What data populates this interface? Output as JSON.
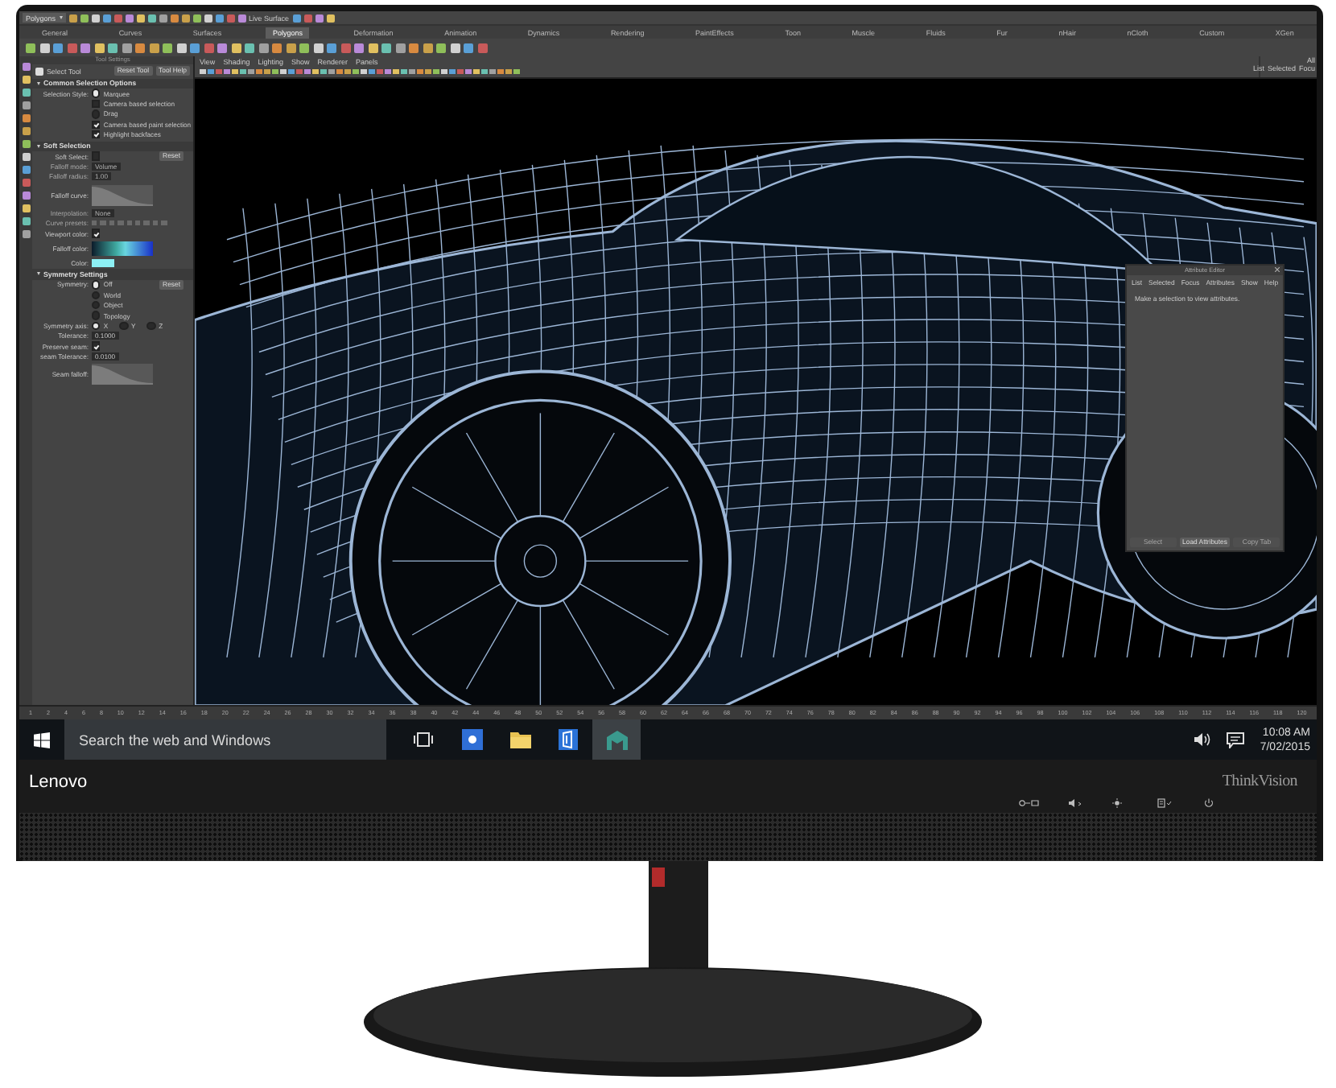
{
  "screen": {
    "top_bar": {
      "mode_menu": "Polygons",
      "live_surface": "Live Surface"
    },
    "shelf_tabs": [
      {
        "label": "General",
        "selected": false
      },
      {
        "label": "Curves",
        "selected": false
      },
      {
        "label": "Surfaces",
        "selected": false
      },
      {
        "label": "Polygons",
        "selected": true
      },
      {
        "label": "Deformation",
        "selected": false
      },
      {
        "label": "Animation",
        "selected": false
      },
      {
        "label": "Dynamics",
        "selected": false
      },
      {
        "label": "Rendering",
        "selected": false
      },
      {
        "label": "PaintEffects",
        "selected": false
      },
      {
        "label": "Toon",
        "selected": false
      },
      {
        "label": "Muscle",
        "selected": false
      },
      {
        "label": "Fluids",
        "selected": false
      },
      {
        "label": "Fur",
        "selected": false
      },
      {
        "label": "nHair",
        "selected": false
      },
      {
        "label": "nCloth",
        "selected": false
      },
      {
        "label": "Custom",
        "selected": false
      },
      {
        "label": "XGen",
        "selected": false
      }
    ],
    "tool_settings": {
      "title": "Tool Settings",
      "tool_name": "Select Tool",
      "buttons": [
        "Reset Tool",
        "Tool Help"
      ],
      "sections": [
        {
          "title": "Common Selection Options",
          "expanded": true,
          "rows": [
            {
              "kind": "radio",
              "label": "Selection Style:",
              "option": "Marquee",
              "selected": true
            },
            {
              "kind": "check",
              "option": "Camera based selection",
              "checked": false
            },
            {
              "kind": "radio",
              "option": "Drag",
              "selected": false
            },
            {
              "kind": "check",
              "option": "Camera based paint selection",
              "checked": true
            },
            {
              "kind": "check",
              "option": "Highlight backfaces",
              "checked": true
            }
          ]
        },
        {
          "title": "Soft Selection",
          "expanded": true,
          "rows": [
            {
              "kind": "check",
              "label": "Soft Select:",
              "checked": false,
              "button": "Reset"
            },
            {
              "kind": "field",
              "label": "Falloff mode:",
              "value": "Volume",
              "disabled": true
            },
            {
              "kind": "field",
              "label": "Falloff radius:",
              "value": "1.00",
              "disabled": true
            },
            {
              "kind": "curve",
              "label": "Falloff curve:"
            },
            {
              "kind": "field",
              "label": "Interpolation:",
              "value": "None",
              "disabled": true
            },
            {
              "kind": "presets",
              "label": "Curve presets:"
            },
            {
              "kind": "check",
              "label": "Viewport color:",
              "checked": true
            },
            {
              "kind": "gradient",
              "label": "Falloff color:"
            },
            {
              "kind": "swatch",
              "label": "Color:"
            }
          ]
        },
        {
          "title": "Symmetry Settings",
          "expanded": true,
          "rows": [
            {
              "kind": "radio",
              "label": "Symmetry:",
              "option": "Off",
              "selected": true,
              "button": "Reset"
            },
            {
              "kind": "radio",
              "option": "World",
              "selected": false
            },
            {
              "kind": "radio",
              "option": "Object",
              "selected": false
            },
            {
              "kind": "radio",
              "option": "Topology",
              "selected": false
            },
            {
              "kind": "axis",
              "label": "Symmetry axis:",
              "options": [
                {
                  "option": "X",
                  "selected": true
                },
                {
                  "option": "Y",
                  "selected": false
                },
                {
                  "option": "Z",
                  "selected": false
                }
              ]
            },
            {
              "kind": "field",
              "label": "Tolerance:",
              "value": "0.1000",
              "disabled": false
            },
            {
              "kind": "check",
              "label": "Preserve seam:",
              "checked": true
            },
            {
              "kind": "field",
              "label": "seam Tolerance:",
              "value": "0.0100",
              "disabled": false
            },
            {
              "kind": "curve",
              "label": "Seam falloff:"
            }
          ]
        }
      ]
    },
    "viewport": {
      "menu": [
        "View",
        "Shading",
        "Lighting",
        "Show",
        "Renderer",
        "Panels"
      ]
    },
    "channel_box": {
      "label": "All",
      "menu": [
        "List",
        "Selected",
        "Focu"
      ]
    },
    "attribute_editor": {
      "title": "Attribute Editor",
      "menu": [
        "List",
        "Selected",
        "Focus",
        "Attributes",
        "Show",
        "Help"
      ],
      "message": "Make a selection to view attributes.",
      "buttons": [
        {
          "label": "Select",
          "disabled": true
        },
        {
          "label": "Load Attributes",
          "disabled": false
        },
        {
          "label": "Copy Tab",
          "disabled": true
        }
      ]
    },
    "timeline": {
      "ticks": [
        "1",
        "2",
        "4",
        "6",
        "8",
        "10",
        "12",
        "14",
        "16",
        "18",
        "20",
        "22",
        "24",
        "26",
        "28",
        "30",
        "32",
        "34",
        "36",
        "38",
        "40",
        "42",
        "44",
        "46",
        "48",
        "50",
        "52",
        "54",
        "56",
        "58",
        "60",
        "62",
        "64",
        "66",
        "68",
        "70",
        "72",
        "74",
        "76",
        "78",
        "80",
        "82",
        "84",
        "86",
        "88",
        "90",
        "92",
        "94",
        "96",
        "98",
        "100",
        "102",
        "104",
        "106",
        "108",
        "110",
        "112",
        "114",
        "116",
        "118",
        "120"
      ]
    },
    "taskbar": {
      "search": {
        "placeholder": "Search the web and Windows"
      },
      "time": "10:08 AM",
      "date": "7/02/2015"
    }
  },
  "bezel": {
    "brand": "Lenovo",
    "model": "ThinkVision"
  }
}
